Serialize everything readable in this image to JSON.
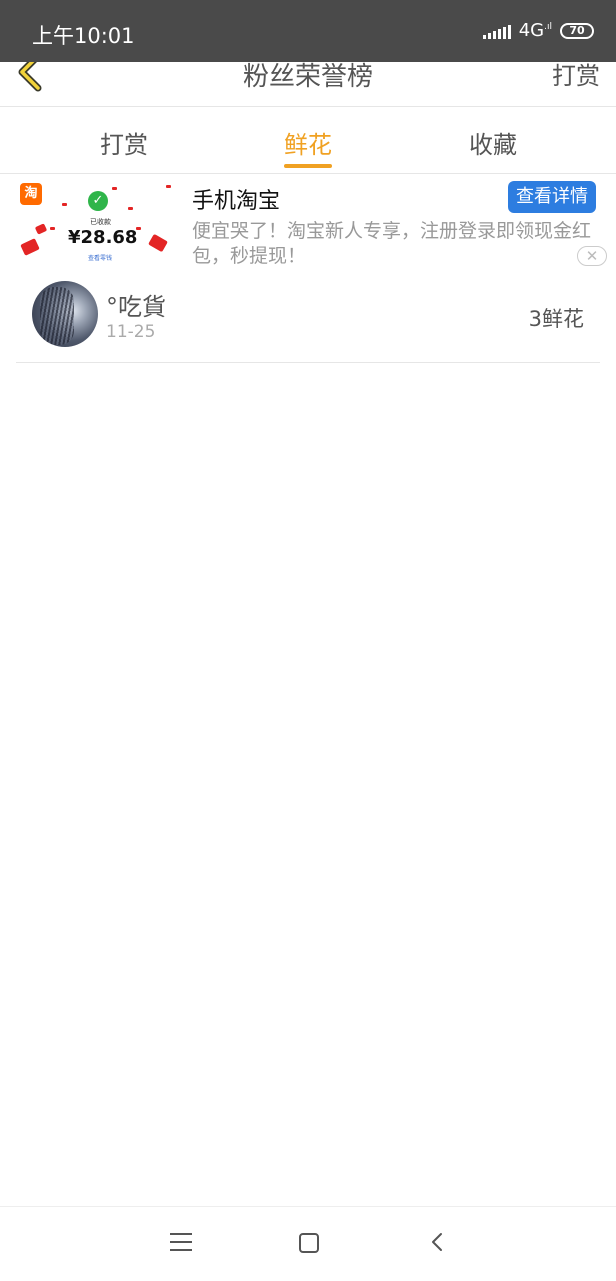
{
  "status_bar": {
    "time": "上午10:01",
    "network": "4G",
    "battery": "70"
  },
  "header": {
    "title": "粉丝荣誉榜",
    "action": "打赏"
  },
  "tabs": [
    {
      "label": "打赏",
      "active": false
    },
    {
      "label": "鲜花",
      "active": true
    },
    {
      "label": "收藏",
      "active": false
    }
  ],
  "ad": {
    "image_logo": "淘",
    "image_received": "已收款",
    "image_amount": "¥28.68",
    "image_link": "查看零钱",
    "app_name": "手机淘宝",
    "button": "查看详情",
    "description": "便宜哭了！淘宝新人专享，注册登录即领现金红包，秒提现！",
    "close": "✕"
  },
  "list": [
    {
      "nickname": "°吃貨",
      "date": "11-25",
      "count": "3鲜花"
    }
  ],
  "colors": {
    "accent": "#f0a122",
    "status_bar": "#4a4a4a",
    "ad_button": "#2d7de0"
  },
  "icons": {
    "back": "chevron-left-icon",
    "nav_menu": "menu-icon",
    "nav_home": "square-home-icon",
    "nav_back": "back-arrow-icon"
  }
}
